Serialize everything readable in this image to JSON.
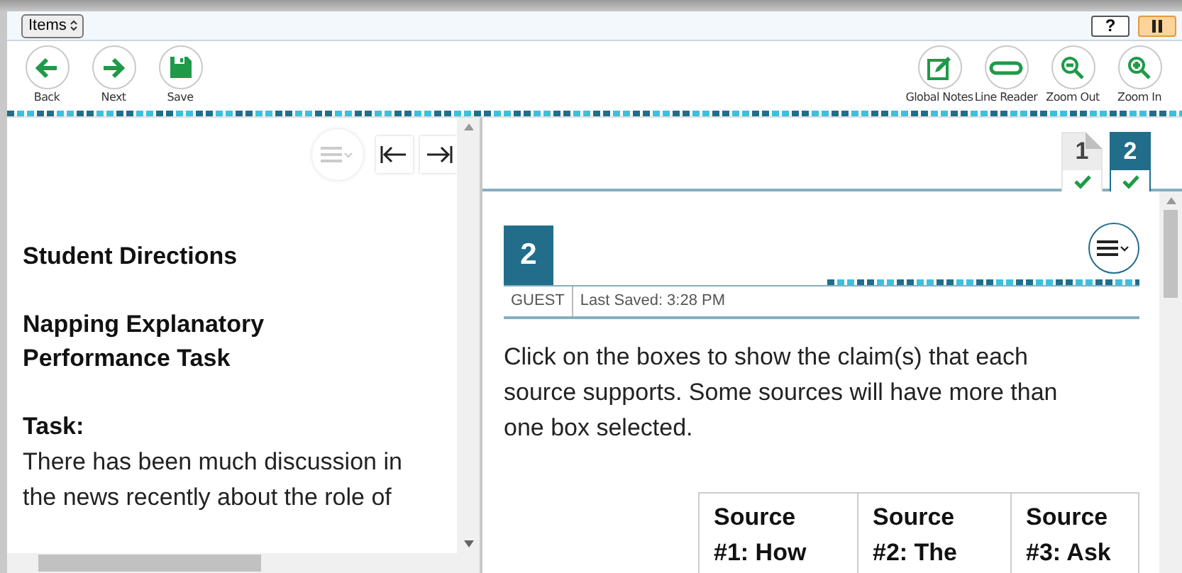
{
  "top_bar": {
    "section_select": "Items",
    "help": "?"
  },
  "toolbar": {
    "left": [
      {
        "kind": "back",
        "label": "Back"
      },
      {
        "kind": "next",
        "label": "Next"
      },
      {
        "kind": "save",
        "label": "Save"
      }
    ],
    "right": [
      {
        "kind": "notes",
        "label": "Global Notes"
      },
      {
        "kind": "line",
        "label": "Line Reader"
      },
      {
        "kind": "zoomout",
        "label": "Zoom Out"
      },
      {
        "kind": "zoomin",
        "label": "Zoom In"
      }
    ]
  },
  "passage": {
    "title": "Student Directions",
    "subtitle": "Napping Explanatory Performance Task",
    "task_heading": "Task:",
    "text": "There has been much discussion in the news recently about the role of"
  },
  "item_tabs": [
    {
      "label": "1",
      "selected": false,
      "answered": true
    },
    {
      "label": "2",
      "selected": true,
      "answered": true
    }
  ],
  "item": {
    "number": "2",
    "user": "GUEST",
    "last_saved": "Last Saved: 3:28 PM",
    "prompt": "Click on the boxes to show the claim(s) that each source supports. Some sources will have more than one box selected.",
    "table": {
      "columns": [
        "Source #1: How",
        "Source #2: The",
        "Source #3: Ask"
      ]
    }
  }
}
